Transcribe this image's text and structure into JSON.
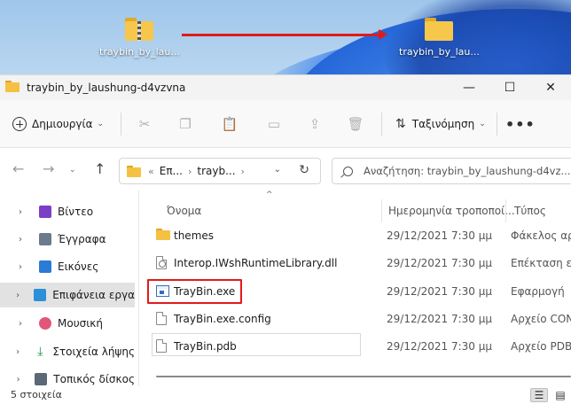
{
  "desktop": {
    "icon_zip_label": "traybin_by_lau...",
    "icon_folder_label": "traybin_by_lau..."
  },
  "window": {
    "title": "traybin_by_laushung-d4vzvna",
    "minimize_glyph": "—",
    "maximize_glyph": "☐",
    "close_glyph": "✕"
  },
  "commandbar": {
    "new_label": "Δημιουργία",
    "sort_label": "Ταξινόμηση",
    "more_glyph": "•••"
  },
  "navigation": {
    "back_glyph": "←",
    "forward_glyph": "→",
    "up_glyph": "↑",
    "breadcrumb_prefix": "«",
    "breadcrumb_1": "Επ...",
    "breadcrumb_2": "trayb...",
    "search_placeholder": "Αναζήτηση: traybin_by_laushung-d4vz..."
  },
  "sidebar": {
    "items": [
      {
        "label": "Βίντεο",
        "icon": "video-icon",
        "color": "#7b3fc5"
      },
      {
        "label": "Έγγραφα",
        "icon": "documents-icon",
        "color": "#6b7a8c"
      },
      {
        "label": "Εικόνες",
        "icon": "pictures-icon",
        "color": "#2a7ad6"
      },
      {
        "label": "Επιφάνεια εργα",
        "icon": "desktop-icon",
        "color": "#2b8fd9"
      },
      {
        "label": "Μουσική",
        "icon": "music-icon",
        "color": "#e0577a"
      },
      {
        "label": "Στοιχεία λήψης",
        "icon": "download-icon",
        "color": "#2e8f52"
      },
      {
        "label": "Τοπικός δίσκος",
        "icon": "disk-icon",
        "color": "#5a6878"
      }
    ]
  },
  "filelist": {
    "columns": {
      "name": "Όνομα",
      "date": "Ημερομηνία τροποποί...",
      "type": "Τύπος"
    },
    "rows": [
      {
        "name": "themes",
        "date": "29/12/2021 7:30 μμ",
        "type": "Φάκελος αρ",
        "icon": "folder-icon"
      },
      {
        "name": "Interop.IWshRuntimeLibrary.dll",
        "date": "29/12/2021 7:30 μμ",
        "type": "Επέκταση εφ",
        "icon": "dll-icon"
      },
      {
        "name": "TrayBin.exe",
        "date": "29/12/2021 7:30 μμ",
        "type": "Εφαρμογή",
        "icon": "exe-icon"
      },
      {
        "name": "TrayBin.exe.config",
        "date": "29/12/2021 7:30 μμ",
        "type": "Αρχείο CON",
        "icon": "config-file-icon"
      },
      {
        "name": "TrayBin.pdb",
        "date": "29/12/2021 7:30 μμ",
        "type": "Αρχείο PDB",
        "icon": "pdb-file-icon"
      }
    ]
  },
  "status": {
    "count": "5 στοιχεία"
  },
  "colors": {
    "highlight": "#e01b1b",
    "folder": "#f5c142"
  }
}
